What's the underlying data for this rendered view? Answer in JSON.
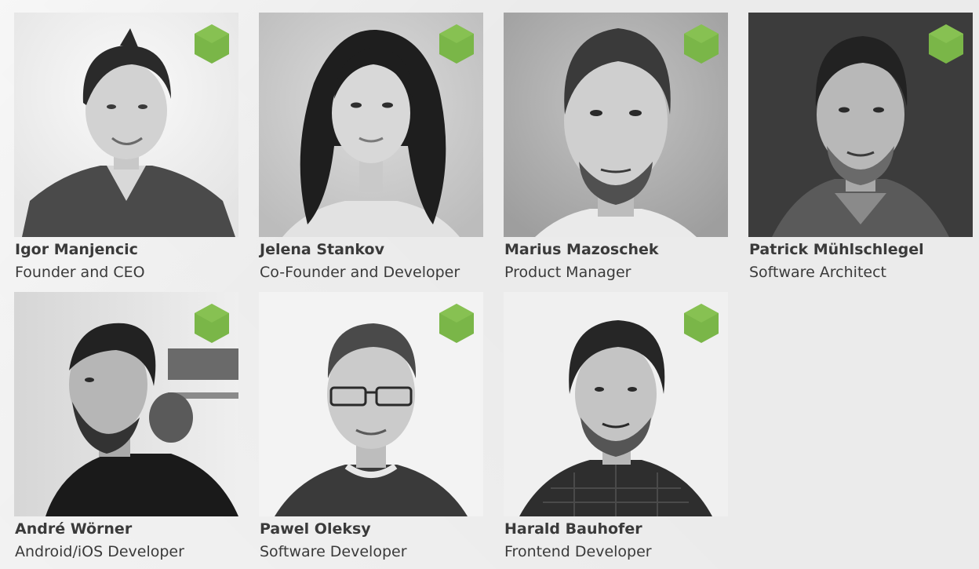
{
  "team": {
    "accent_color": "#7ab648",
    "badge_icon": "green-hexagon-icon",
    "members": [
      {
        "name": "Igor Manjencic",
        "role": "Founder and CEO"
      },
      {
        "name": "Jelena Stankov",
        "role": "Co-Founder and Developer"
      },
      {
        "name": "Marius Mazoschek",
        "role": "Product Manager"
      },
      {
        "name": "Patrick Mühlschlegel",
        "role": "Software Architect"
      },
      {
        "name": "André Wörner",
        "role": "Android/iOS Developer"
      },
      {
        "name": "Pawel Oleksy",
        "role": "Software Developer"
      },
      {
        "name": "Harald Bauhofer",
        "role": "Frontend Developer"
      }
    ]
  }
}
